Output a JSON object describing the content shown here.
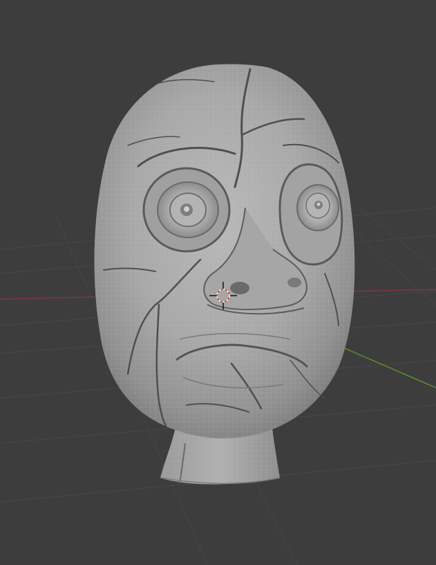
{
  "viewport": {
    "background": "#3d3d3d",
    "grid_color": "#4a4a4a",
    "x_axis_color": "#8a3a44",
    "y_axis_color": "#6c8f3a"
  },
  "model": {
    "skin_color": "#a9a9a9",
    "crack_color": "#4f4f4f",
    "cursor_color": "#d8262c"
  }
}
